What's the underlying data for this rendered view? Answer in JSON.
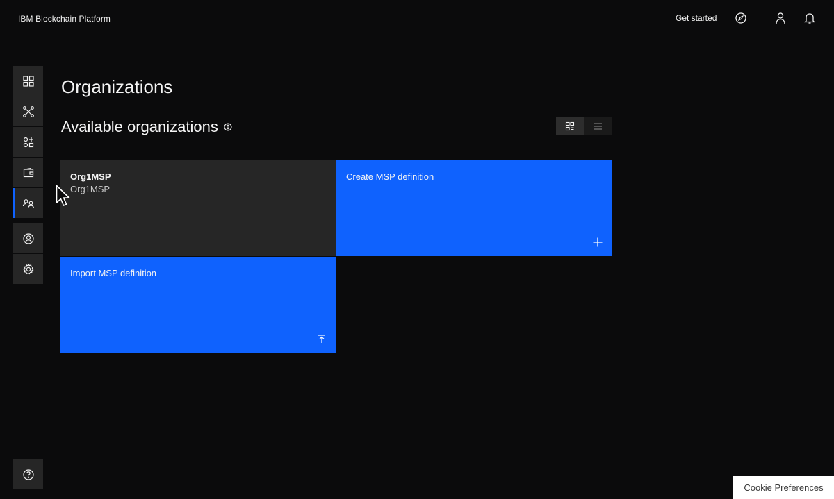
{
  "header": {
    "brand": "IBM Blockchain Platform",
    "get_started": "Get started",
    "icons": [
      "compass-icon",
      "user-icon",
      "notification-icon"
    ]
  },
  "sidenav": {
    "items": [
      {
        "name": "overview",
        "icon": "dashboard-grid-icon"
      },
      {
        "name": "nodes",
        "icon": "network-icon"
      },
      {
        "name": "channels",
        "icon": "channels-icon"
      },
      {
        "name": "wallet",
        "icon": "wallet-icon"
      },
      {
        "name": "organizations",
        "icon": "organizations-icon",
        "active": true
      },
      {
        "name": "users",
        "icon": "user-avatar-icon"
      },
      {
        "name": "settings",
        "icon": "settings-gear-icon"
      },
      {
        "name": "help",
        "icon": "help-icon"
      }
    ]
  },
  "main": {
    "title": "Organizations",
    "section_title": "Available organizations",
    "view_toggle": {
      "selected": "tile"
    },
    "tiles": [
      {
        "type": "org",
        "title": "Org1MSP",
        "subtitle": "Org1MSP"
      },
      {
        "type": "action",
        "label": "Create MSP definition",
        "icon": "add-icon"
      },
      {
        "type": "action",
        "label": "Import MSP definition",
        "icon": "upload-icon"
      }
    ]
  },
  "cookie": {
    "label": "Cookie Preferences"
  },
  "colors": {
    "accent": "#0f62fe",
    "background": "#0b0b0c",
    "tile": "#262626"
  }
}
